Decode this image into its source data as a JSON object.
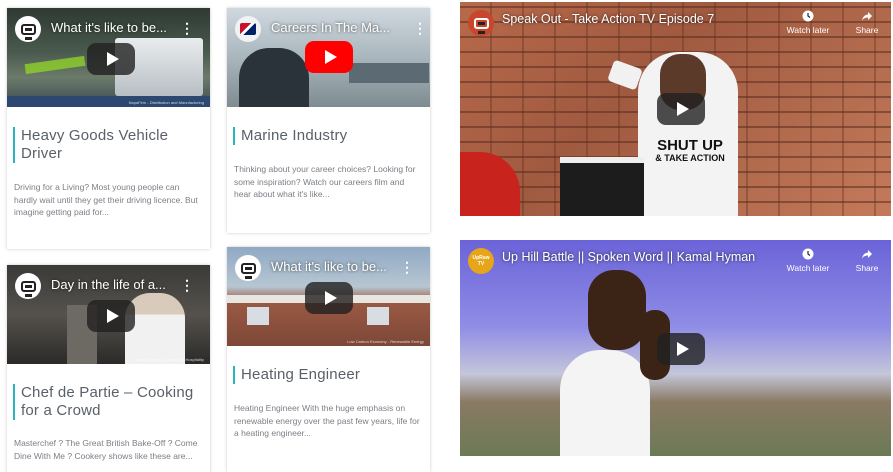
{
  "cards": [
    {
      "video_title": "What it's like to be...",
      "caption": "NapaFirm - Distribution and Manufacturing",
      "title": "Heavy Goods Vehicle Driver",
      "description": "Driving for a Living? Most young people can hardly wait until they get their driving licence. But imagine getting paid for..."
    },
    {
      "video_title": "Careers In The Ma...",
      "caption": "",
      "title": "Marine Industry",
      "description": "Thinking about your career choices? Looking for some inspiration? Watch our careers film and hear about what it's like..."
    },
    {
      "video_title": "Day in the life of a...",
      "caption": "Visitor Economy - Catering & Hospitality",
      "title": "Chef de Partie – Cooking for a Crowd",
      "description": "Masterchef ?   The Great British Bake-Off ?   Come Dine With Me ? Cookery shows like these are..."
    },
    {
      "video_title": "What it's like to be...",
      "caption": "Low Carbon Economy - Renewable Energy",
      "title": "Heating Engineer",
      "description": "Heating Engineer With the huge emphasis on renewable energy over the past few years, life for a heating engineer..."
    }
  ],
  "videos": [
    {
      "title": "Speak Out - Take Action TV Episode 7",
      "watch_later": "Watch later",
      "share": "Share",
      "shirt_line1": "SHUT UP",
      "shirt_line2": "& TAKE ACTION"
    },
    {
      "title": "Up Hill Battle || Spoken Word || Kamal Hyman",
      "watch_later": "Watch later",
      "share": "Share",
      "channel_badge": "UpRaw TV"
    }
  ],
  "colors": {
    "accent": "#2bb3c0",
    "youtube_red": "#ff0000"
  }
}
